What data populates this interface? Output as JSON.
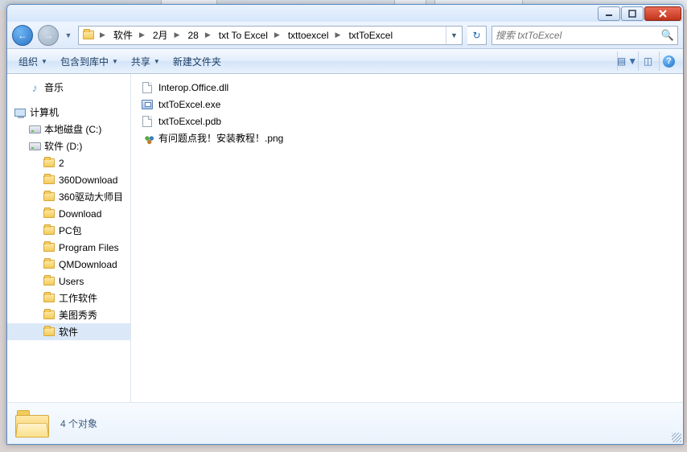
{
  "breadcrumbs": [
    "软件",
    "2月",
    "28",
    "txt To Excel",
    "txttoexcel",
    "txtToExcel"
  ],
  "search": {
    "placeholder": "搜索 txtToExcel"
  },
  "toolbar": {
    "organize": "组织",
    "include": "包含到库中",
    "share": "共享",
    "newfolder": "新建文件夹"
  },
  "sidebar": {
    "music": "音乐",
    "computer": "计算机",
    "drive_c": "本地磁盘 (C:)",
    "drive_d": "软件 (D:)",
    "folders": [
      "2",
      "360Download",
      "360驱动大师目",
      "Download",
      "PC包",
      "Program Files",
      "QMDownload",
      "Users",
      "工作软件",
      "美图秀秀",
      "软件"
    ]
  },
  "files": [
    {
      "name": "Interop.Office.dll",
      "icon": "doc"
    },
    {
      "name": "txtToExcel.exe",
      "icon": "exe"
    },
    {
      "name": "txtToExcel.pdb",
      "icon": "doc"
    },
    {
      "name": "有问题点我！安装教程！.png",
      "icon": "pic"
    }
  ],
  "status": {
    "count_label": "4 个对象"
  }
}
